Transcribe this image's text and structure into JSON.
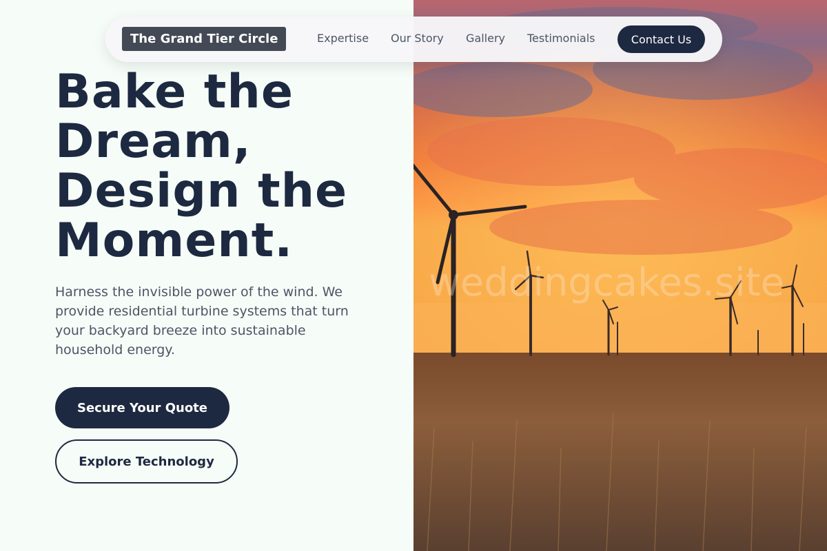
{
  "nav": {
    "logo": "The Grand Tier Circle",
    "links": [
      "Expertise",
      "Our Story",
      "Gallery",
      "Testimonials"
    ],
    "contact_label": "Contact Us"
  },
  "hero": {
    "headline_lines": [
      "Bake the",
      "Dream,",
      "Design the",
      "Moment."
    ],
    "description": "Harness the invisible power of the wind. We provide residential turbine systems that turn your backyard breeze into sustainable household energy.",
    "primary_cta": "Secure Your Quote",
    "secondary_cta": "Explore Technology",
    "watermark": "weddingcakes.site"
  },
  "colors": {
    "navy": "#1d2940",
    "logo_bg": "#434955",
    "page_bg": "#f6fcf7",
    "sky_orange": "#f47a3e"
  }
}
